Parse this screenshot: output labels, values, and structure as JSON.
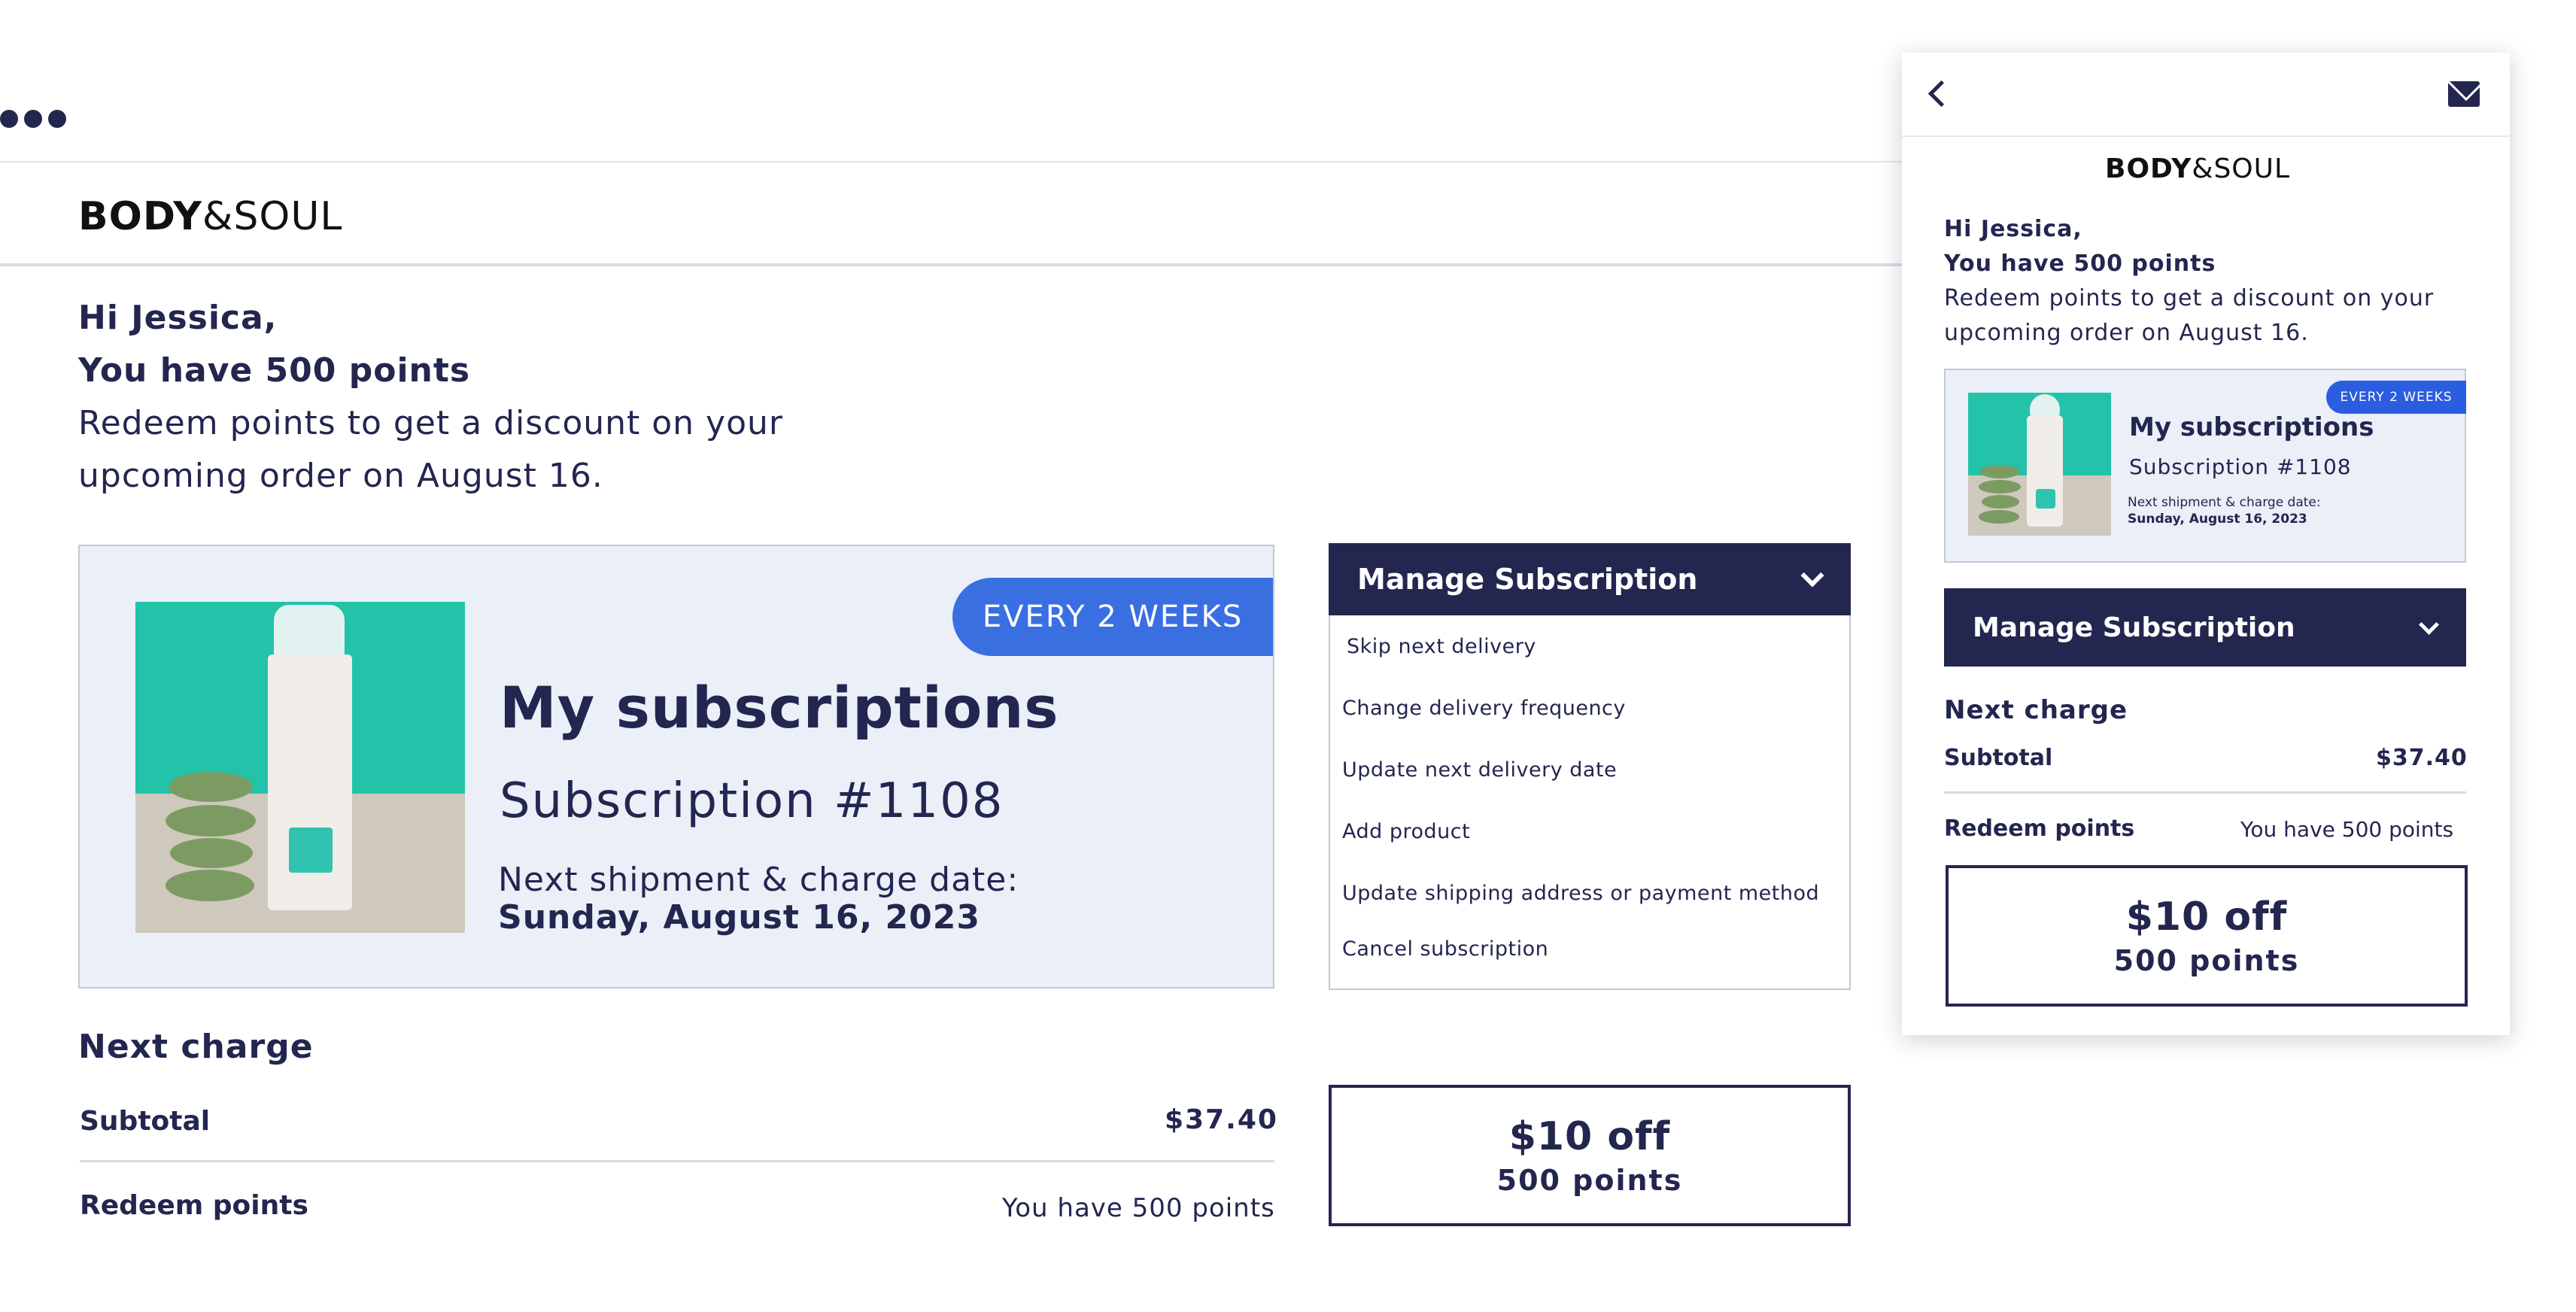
{
  "brand": {
    "name_bold": "BODY",
    "name_light": "&SOUL"
  },
  "greeting": {
    "hi": "Hi Jessica,",
    "points": "You have 500 points",
    "redeem_line1": "Redeem points to get a discount on your",
    "redeem_line2": "upcoming order on August  16.",
    "redeem_full": "Redeem points to get a discount on your upcoming order on August  16."
  },
  "subscription": {
    "badge": "EVERY 2 WEEKS",
    "title": "My subscriptions",
    "number": "Subscription #1108",
    "next_label": "Next shipment & charge date:",
    "next_date": "Sunday, August 16, 2023"
  },
  "manage": {
    "title": "Manage Subscription",
    "items": [
      "Skip next delivery",
      "Change delivery frequency",
      "Update next delivery date",
      "Add product",
      "Update shipping address or payment method",
      "Cancel subscription"
    ]
  },
  "charge": {
    "title": "Next charge",
    "subtotal_label": "Subtotal",
    "subtotal_value": "$37.40",
    "redeem_label": "Redeem points",
    "redeem_value": "You have 500 points"
  },
  "discount": {
    "amount": "$10 off",
    "points": "500 points"
  },
  "icons": {
    "back": "chevron-left-icon",
    "mail": "mail-icon",
    "dots": "dots-icon",
    "dropdown": "chevron-down-icon"
  },
  "colors": {
    "navy": "#23264f",
    "badge_blue": "#3a6fe2",
    "card_bg": "#eaeff8",
    "teal": "#22c3a9"
  }
}
